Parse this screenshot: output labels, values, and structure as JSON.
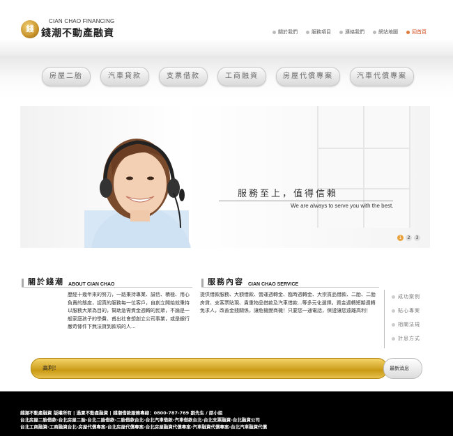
{
  "header": {
    "logo_en": "CIAN CHAO FINANCING",
    "logo_zh": "錢潮不動產融資",
    "nav": [
      {
        "label": "關於我們",
        "icon": "dot-icon"
      },
      {
        "label": "服務項目",
        "icon": "dot-icon"
      },
      {
        "label": "連絡我們",
        "icon": "dot-icon"
      },
      {
        "label": "網站地圖",
        "icon": "dot-icon"
      },
      {
        "label": "回首頁",
        "icon": "home-dot-icon"
      }
    ]
  },
  "menu": [
    {
      "label": "房屋二胎"
    },
    {
      "label": "汽車貸款"
    },
    {
      "label": "支票借款"
    },
    {
      "label": "工商融資"
    },
    {
      "label": "房屋代償專案"
    },
    {
      "label": "汽車代償專案"
    }
  ],
  "banner": {
    "tagline": "服務至上，值得信賴",
    "tagline_en": "We are always to serve you with the best.",
    "pager": [
      "1",
      "2",
      "3"
    ],
    "active_page": "1"
  },
  "about": {
    "title_zh": "關於錢潮",
    "title_en": "ABOUT CIAN CHAO",
    "text": "歷經十幾年來的努力，一路秉持專業、誠信、積極、用心負責的態度，認真的服務每一位客戶，自創立開始就秉持以服務大眾為目的，幫助急需資金週轉的民眾，不論是一般家庭孩子的學費、甫出社會想創立公司事業，或是銀行嚴苛條件下無法貸到款項的人..."
  },
  "service": {
    "title_zh": "服務內容",
    "title_en": "CIAN CHAO SERVICE",
    "text": "提供借款服務、大額借款、營運週轉金、臨時週轉金、大宗貨品借款、二胎、二胎房貸、支客票貼現、貴重物品借款及汽車借款...等多元化選擇。資金週轉短期週轉免求人，改善金錢關係，讓危機變商機！只要您一通電話，保證讓您遠離高利！"
  },
  "sidelinks": [
    {
      "label": "成功案例"
    },
    {
      "label": "貼心專案"
    },
    {
      "label": "相關法規"
    },
    {
      "label": "計息方式"
    }
  ],
  "ticker": {
    "text": "高利！",
    "button": "最新消息"
  },
  "footer": {
    "line1": "錢潮不動產融資 版權所有 | 過夏不動產融資 | 錢潮借款服務專線：0800-787-769 劉先生 / 邵小姐",
    "line2": "台北房屋二胎借款-台北房屋二胎-台北二胎借款-二胎借款台北-台北汽車借款-汽車借款台北-台北支票融資-台北融資公司",
    "line3": "台北工商融資-工商融資台北-房屋代償專案-台北房屋代償專案-台北房屋融資代償專案-汽車融資代償專案-台北汽車融資代償"
  }
}
